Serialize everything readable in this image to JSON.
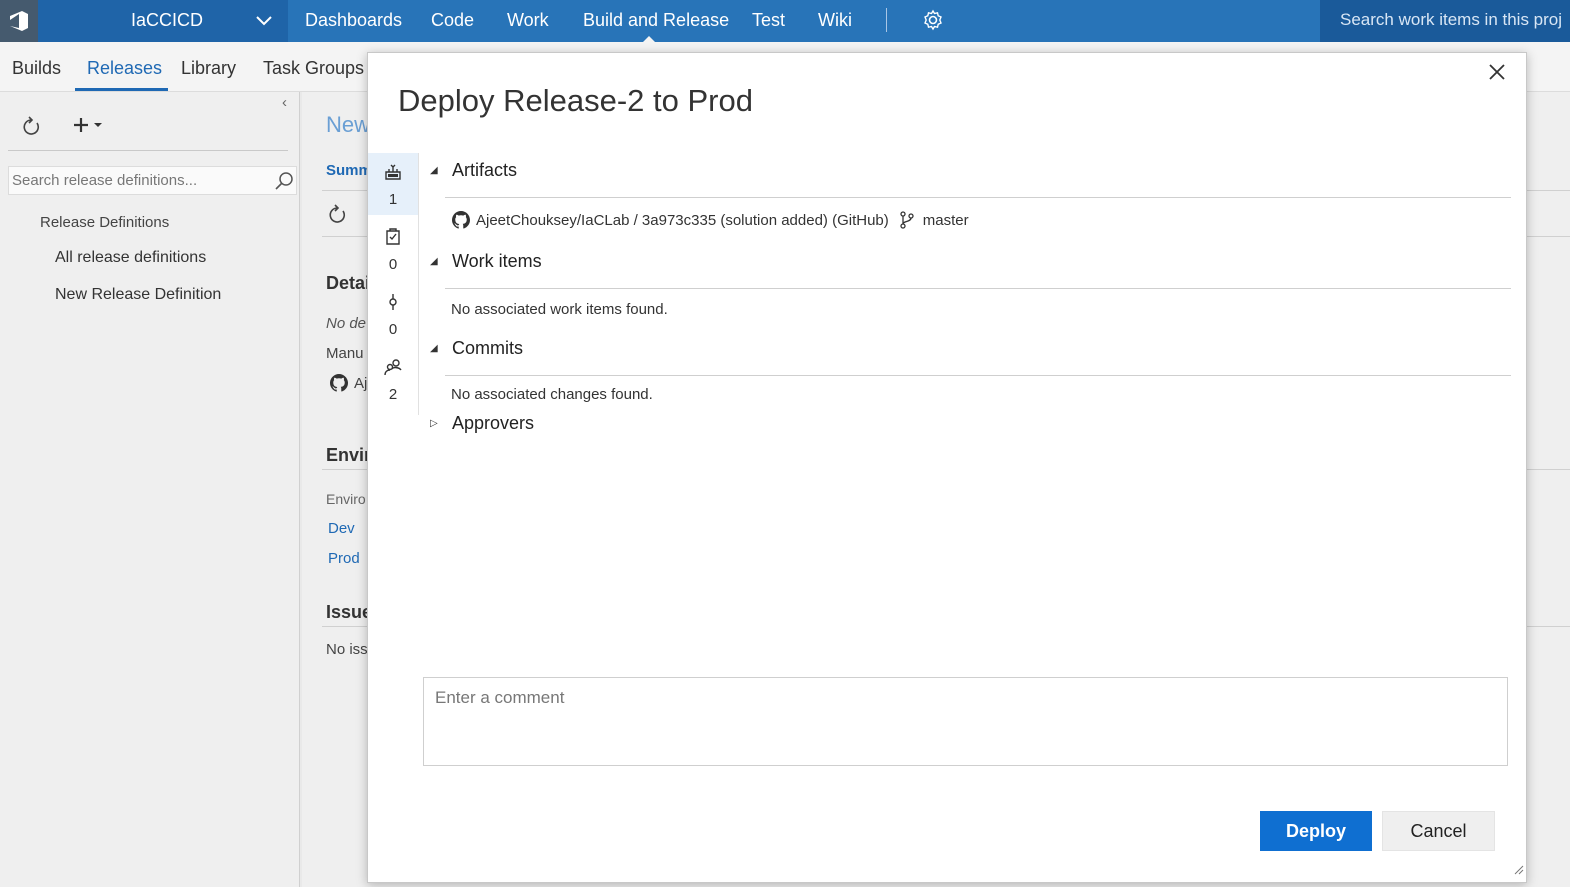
{
  "topbar": {
    "project": "IaCCICD",
    "nav": [
      "Dashboards",
      "Code",
      "Work",
      "Build and Release",
      "Test",
      "Wiki"
    ],
    "active_nav": "Build and Release",
    "search_placeholder": "Search work items in this proj"
  },
  "subnav": {
    "tabs": [
      "Builds",
      "Releases",
      "Library",
      "Task Groups"
    ],
    "active": "Releases"
  },
  "left_pane": {
    "search_placeholder": "Search release definitions...",
    "section_title": "Release Definitions",
    "items": [
      "All release definitions",
      "New Release Definition"
    ]
  },
  "background_main": {
    "title": "New",
    "tab": "Summ",
    "details_header": "Detai",
    "details_text": "No de",
    "manual_text": "Manu",
    "artifact_text": "Aj",
    "env_header": "Envir",
    "env_col": "Enviro",
    "envs": [
      "Dev",
      "Prod"
    ],
    "issues_header": "Issue",
    "issues_text": "No iss"
  },
  "dialog": {
    "title": "Deploy Release-2 to Prod",
    "side_tabs": [
      {
        "icon": "artifact-icon",
        "count": "1"
      },
      {
        "icon": "work-items-icon",
        "count": "0"
      },
      {
        "icon": "commit-icon",
        "count": "0"
      },
      {
        "icon": "approvers-icon",
        "count": "2"
      }
    ],
    "sections": {
      "artifacts": {
        "title": "Artifacts",
        "artifact": "AjeetChouksey/IaCLab / 3a973c335 (solution added) (GitHub)",
        "branch": "master"
      },
      "work_items": {
        "title": "Work items",
        "empty": "No associated work items found."
      },
      "commits": {
        "title": "Commits",
        "empty": "No associated changes found."
      },
      "approvers": {
        "title": "Approvers"
      }
    },
    "comment_placeholder": "Enter a comment",
    "deploy_label": "Deploy",
    "cancel_label": "Cancel"
  },
  "colors": {
    "topbar": "#2874b8",
    "accent": "#0f6fd1",
    "link": "#1f69b4"
  }
}
